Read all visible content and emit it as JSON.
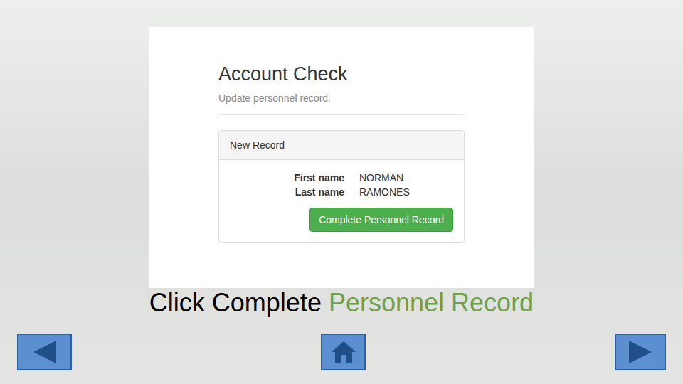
{
  "card": {
    "title": "Account Check",
    "subtitle": "Update personnel record."
  },
  "panel": {
    "heading": "New Record",
    "fields": [
      {
        "label": "First name",
        "value": "NORMAN"
      },
      {
        "label": "Last name",
        "value": "RAMONES"
      }
    ],
    "button": "Complete Personnel Record"
  },
  "caption": [
    {
      "text": "Click Complete",
      "color": "#000000"
    },
    {
      "text": "Personnel Record",
      "color": "#6f9f4a"
    }
  ]
}
